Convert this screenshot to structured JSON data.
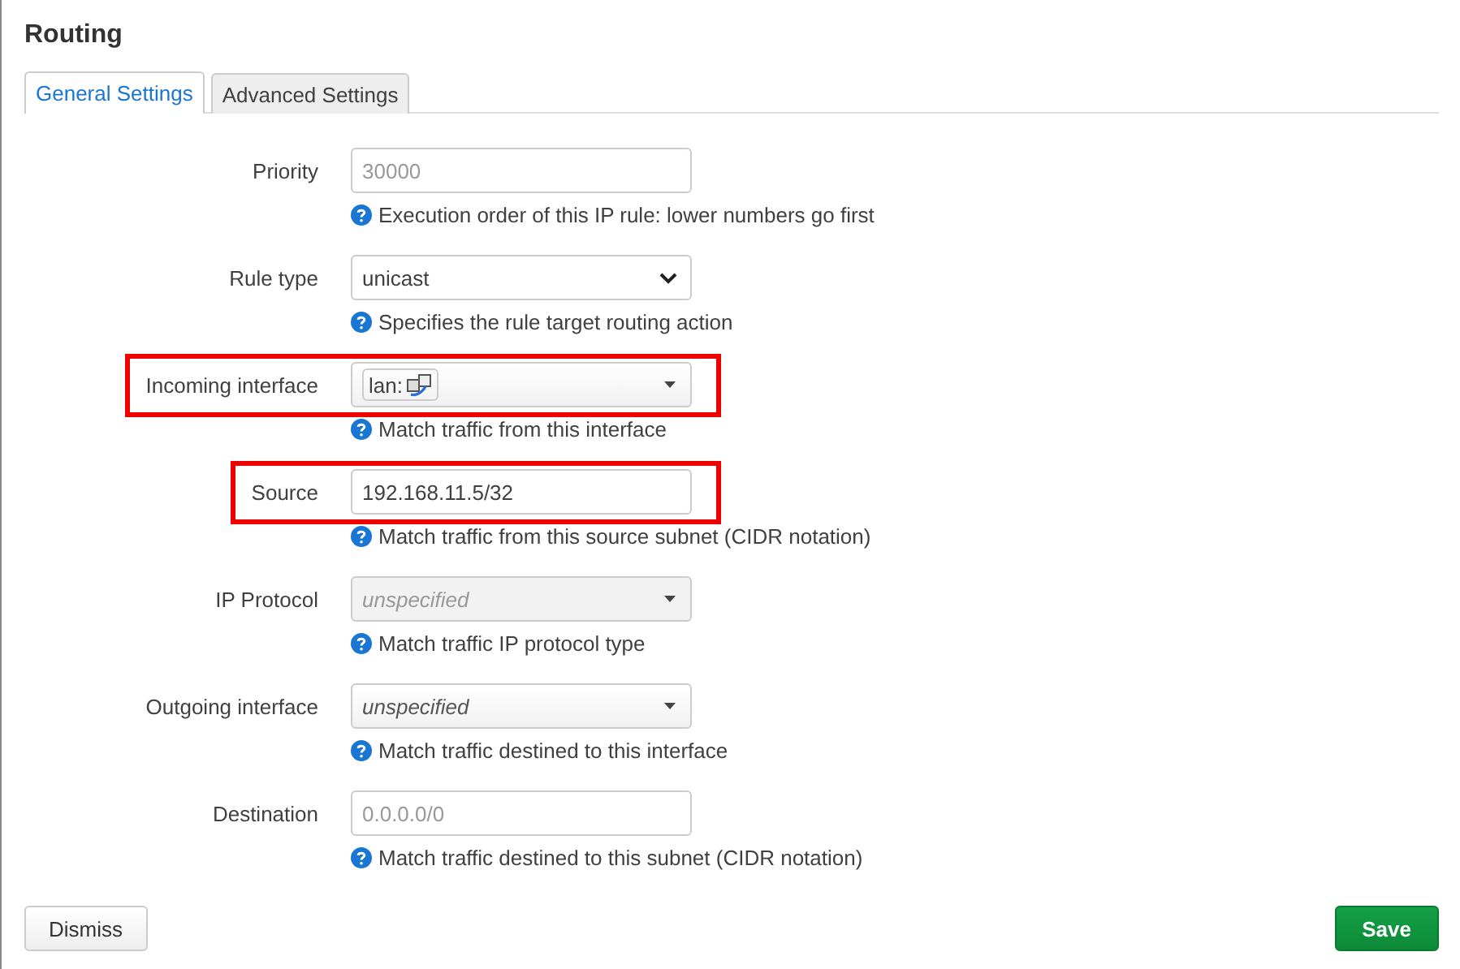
{
  "title": "Routing",
  "tabs": [
    {
      "label": "General Settings",
      "selected": true
    },
    {
      "label": "Advanced Settings",
      "selected": false
    }
  ],
  "fields": [
    {
      "label": "Priority",
      "kind": "input",
      "placeholder": "30000",
      "hint": "Execution order of this IP rule: lower numbers go first",
      "highlighted": false
    },
    {
      "label": "Rule type",
      "kind": "select",
      "value": "unicast",
      "hint": "Specifies the rule target routing action",
      "highlighted": false
    },
    {
      "label": "Incoming interface",
      "kind": "chip-dropdown",
      "value": "lan:",
      "hint": "Match traffic from this interface",
      "highlighted": true
    },
    {
      "label": "Source",
      "kind": "input",
      "value": "192.168.11.5/32",
      "hint": "Match traffic from this source subnet (CIDR notation)",
      "highlighted": true
    },
    {
      "label": "IP Protocol",
      "kind": "dropdown",
      "placeholder": "unspecified",
      "disabled": true,
      "hint": "Match traffic IP protocol type",
      "highlighted": false
    },
    {
      "label": "Outgoing interface",
      "kind": "dropdown",
      "placeholder": "unspecified",
      "disabled": false,
      "hint": "Match traffic destined to this interface",
      "highlighted": false
    },
    {
      "label": "Destination",
      "kind": "input",
      "placeholder": "0.0.0.0/0",
      "hint": "Match traffic destined to this subnet (CIDR notation)",
      "highlighted": false
    }
  ],
  "buttons": {
    "dismiss": "Dismiss",
    "save": "Save"
  }
}
